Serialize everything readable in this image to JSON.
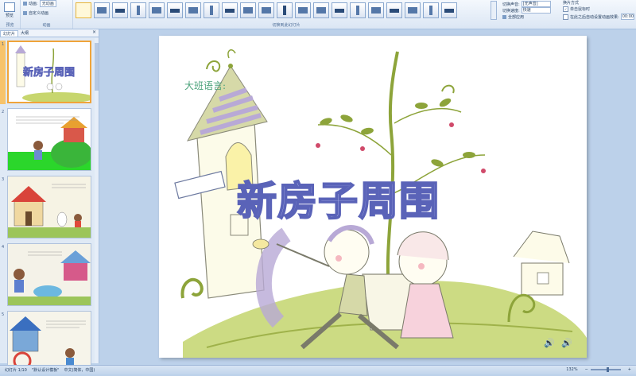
{
  "ribbon": {
    "preview_label": "预览",
    "animation_label": "动画:",
    "animation_value": "无动画",
    "custom_anim_label": "自定义动画",
    "group_preview": "预览",
    "group_anim": "动画",
    "group_switch": "切换到此幻灯片",
    "sound_label": "切换声音:",
    "sound_value": "[无声音]",
    "speed_label": "切换速度:",
    "speed_value": "快速",
    "apply_all": "全部应用",
    "switch_mode": "换片方式",
    "on_click": "单击鼠标时",
    "auto_after": "在此之后自动设置动画效果:",
    "auto_time": "00:00"
  },
  "panel": {
    "tab_slides": "幻灯片",
    "tab_outline": "大纲",
    "close": "×",
    "slide_numbers": [
      "1",
      "2",
      "3",
      "4",
      "5"
    ]
  },
  "slide": {
    "subtitle": "大班语言:",
    "title": "新房子周围"
  },
  "status": {
    "slide_info": "幻灯片 1/10",
    "theme": "\"默认设计模板\"",
    "lang": "中文(简体，中国)",
    "zoom": "132%"
  },
  "colors": {
    "title_fill": "#c9cdfa",
    "title_stroke": "#5a63b8",
    "grass": "#b6c860"
  }
}
